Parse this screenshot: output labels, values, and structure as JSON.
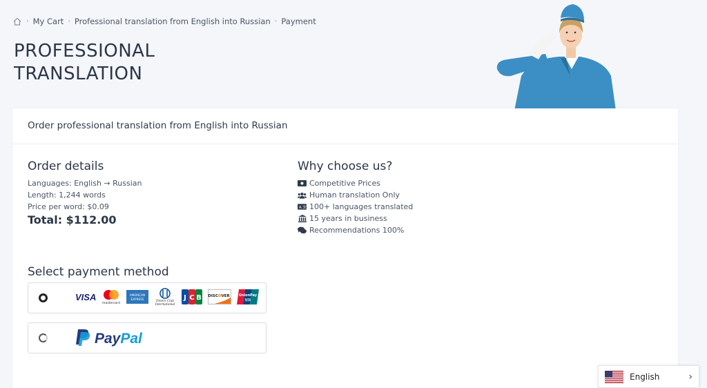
{
  "breadcrumb": {
    "home_icon": "home-icon",
    "items": [
      "My Cart",
      "Professional translation from English into Russian",
      "Payment"
    ]
  },
  "page": {
    "title_line1": "PROFESSIONAL",
    "title_line2": "TRANSLATION"
  },
  "card": {
    "header": "Order professional translation from English into Russian"
  },
  "order": {
    "title": "Order details",
    "languages": "Languages: English → Russian",
    "length": "Length: 1,244 words",
    "price": "Price per word: $0.09",
    "total": "Total: $112.00"
  },
  "why": {
    "title": "Why choose us?",
    "items": [
      {
        "icon": "money-icon",
        "label": "Competitive Prices"
      },
      {
        "icon": "users-icon",
        "label": "Human translation Only"
      },
      {
        "icon": "language-icon",
        "label": "100+ languages translated"
      },
      {
        "icon": "bank-icon",
        "label": "15 years in business"
      },
      {
        "icon": "comments-icon",
        "label": "Recommendations 100%"
      }
    ]
  },
  "payment": {
    "title": "Select payment method",
    "options": [
      {
        "id": "cards",
        "selected": true,
        "logos": [
          "VISA",
          "mastercard",
          "AMERICAN EXPRESS",
          "Diners Club International",
          "JCB",
          "DISCOVER",
          "UnionPay"
        ]
      },
      {
        "id": "paypal",
        "selected": false,
        "label_pay": "Pay",
        "label_pal": "Pal"
      }
    ]
  },
  "language_switcher": {
    "label": "English",
    "flag_icon": "us-flag-icon"
  },
  "colors": {
    "page_bg": "#f5f6fa",
    "text_dark": "#2b3648",
    "paypal_dark": "#253b80",
    "paypal_light": "#179bd7",
    "attendant_uniform": "#3b8fc4"
  }
}
